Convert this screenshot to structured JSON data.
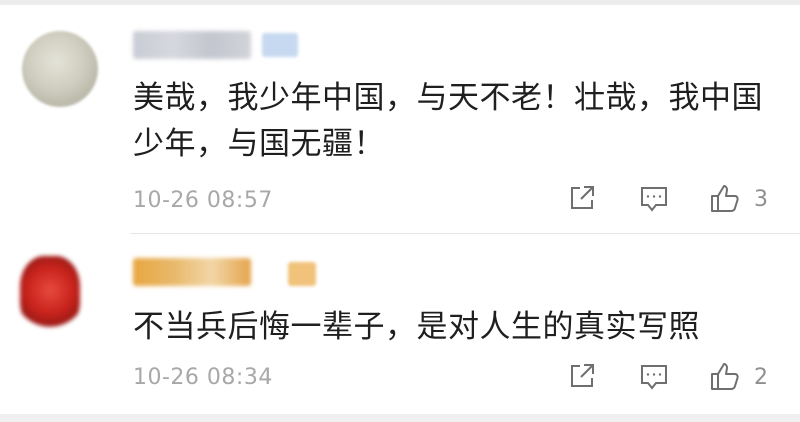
{
  "comments": [
    {
      "text": "美哉，我少年中国，与天不老！壮哉，我中国少年，与国无疆！",
      "time": "10-26 08:57",
      "likes": "3"
    },
    {
      "text": "不当兵后悔一辈子，是对人生的真实写照",
      "time": "10-26 08:34",
      "likes": "2"
    }
  ],
  "icons": {
    "share": "share-icon",
    "reply": "comment-icon",
    "like": "thumbs-up-icon"
  }
}
